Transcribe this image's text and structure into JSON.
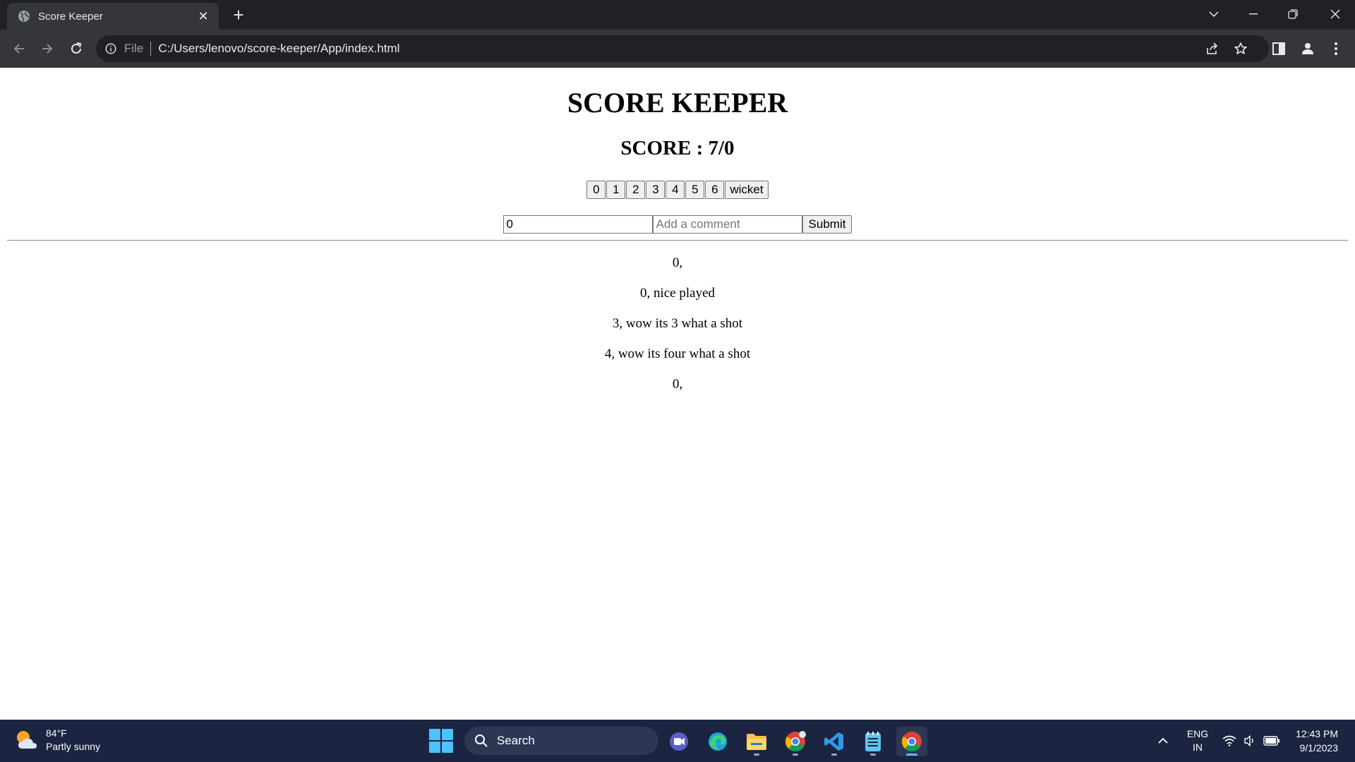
{
  "browser": {
    "tab_title": "Score Keeper",
    "new_tab_symbol": "+",
    "url_scheme": "File",
    "url": "C:/Users/lenovo/score-keeper/App/index.html"
  },
  "page": {
    "title": "SCORE KEEPER",
    "score_text": "SCORE : 7/0",
    "run_buttons": [
      "0",
      "1",
      "2",
      "3",
      "4",
      "5",
      "6",
      "wicket"
    ],
    "runs_input_value": "0",
    "comment_placeholder": "Add a comment",
    "submit_label": "Submit",
    "log": [
      "0,",
      "0, nice played",
      "3, wow its 3 what a shot",
      "4, wow its four what a shot",
      "0,"
    ]
  },
  "taskbar": {
    "weather_temp": "84°F",
    "weather_desc": "Partly sunny",
    "search_label": "Search",
    "language_top": "ENG",
    "language_bottom": "IN",
    "time": "12:43 PM",
    "date": "9/1/2023",
    "apps": [
      "teams-meet-icon",
      "edge-icon",
      "file-explorer-icon",
      "chrome-icon",
      "vscode-icon",
      "notepad-icon",
      "chrome-icon"
    ]
  },
  "colors": {
    "chrome_dark": "#202124",
    "chrome_toolbar": "#35363a",
    "taskbar": "#1b2440",
    "accent": "#4cc2ff"
  }
}
